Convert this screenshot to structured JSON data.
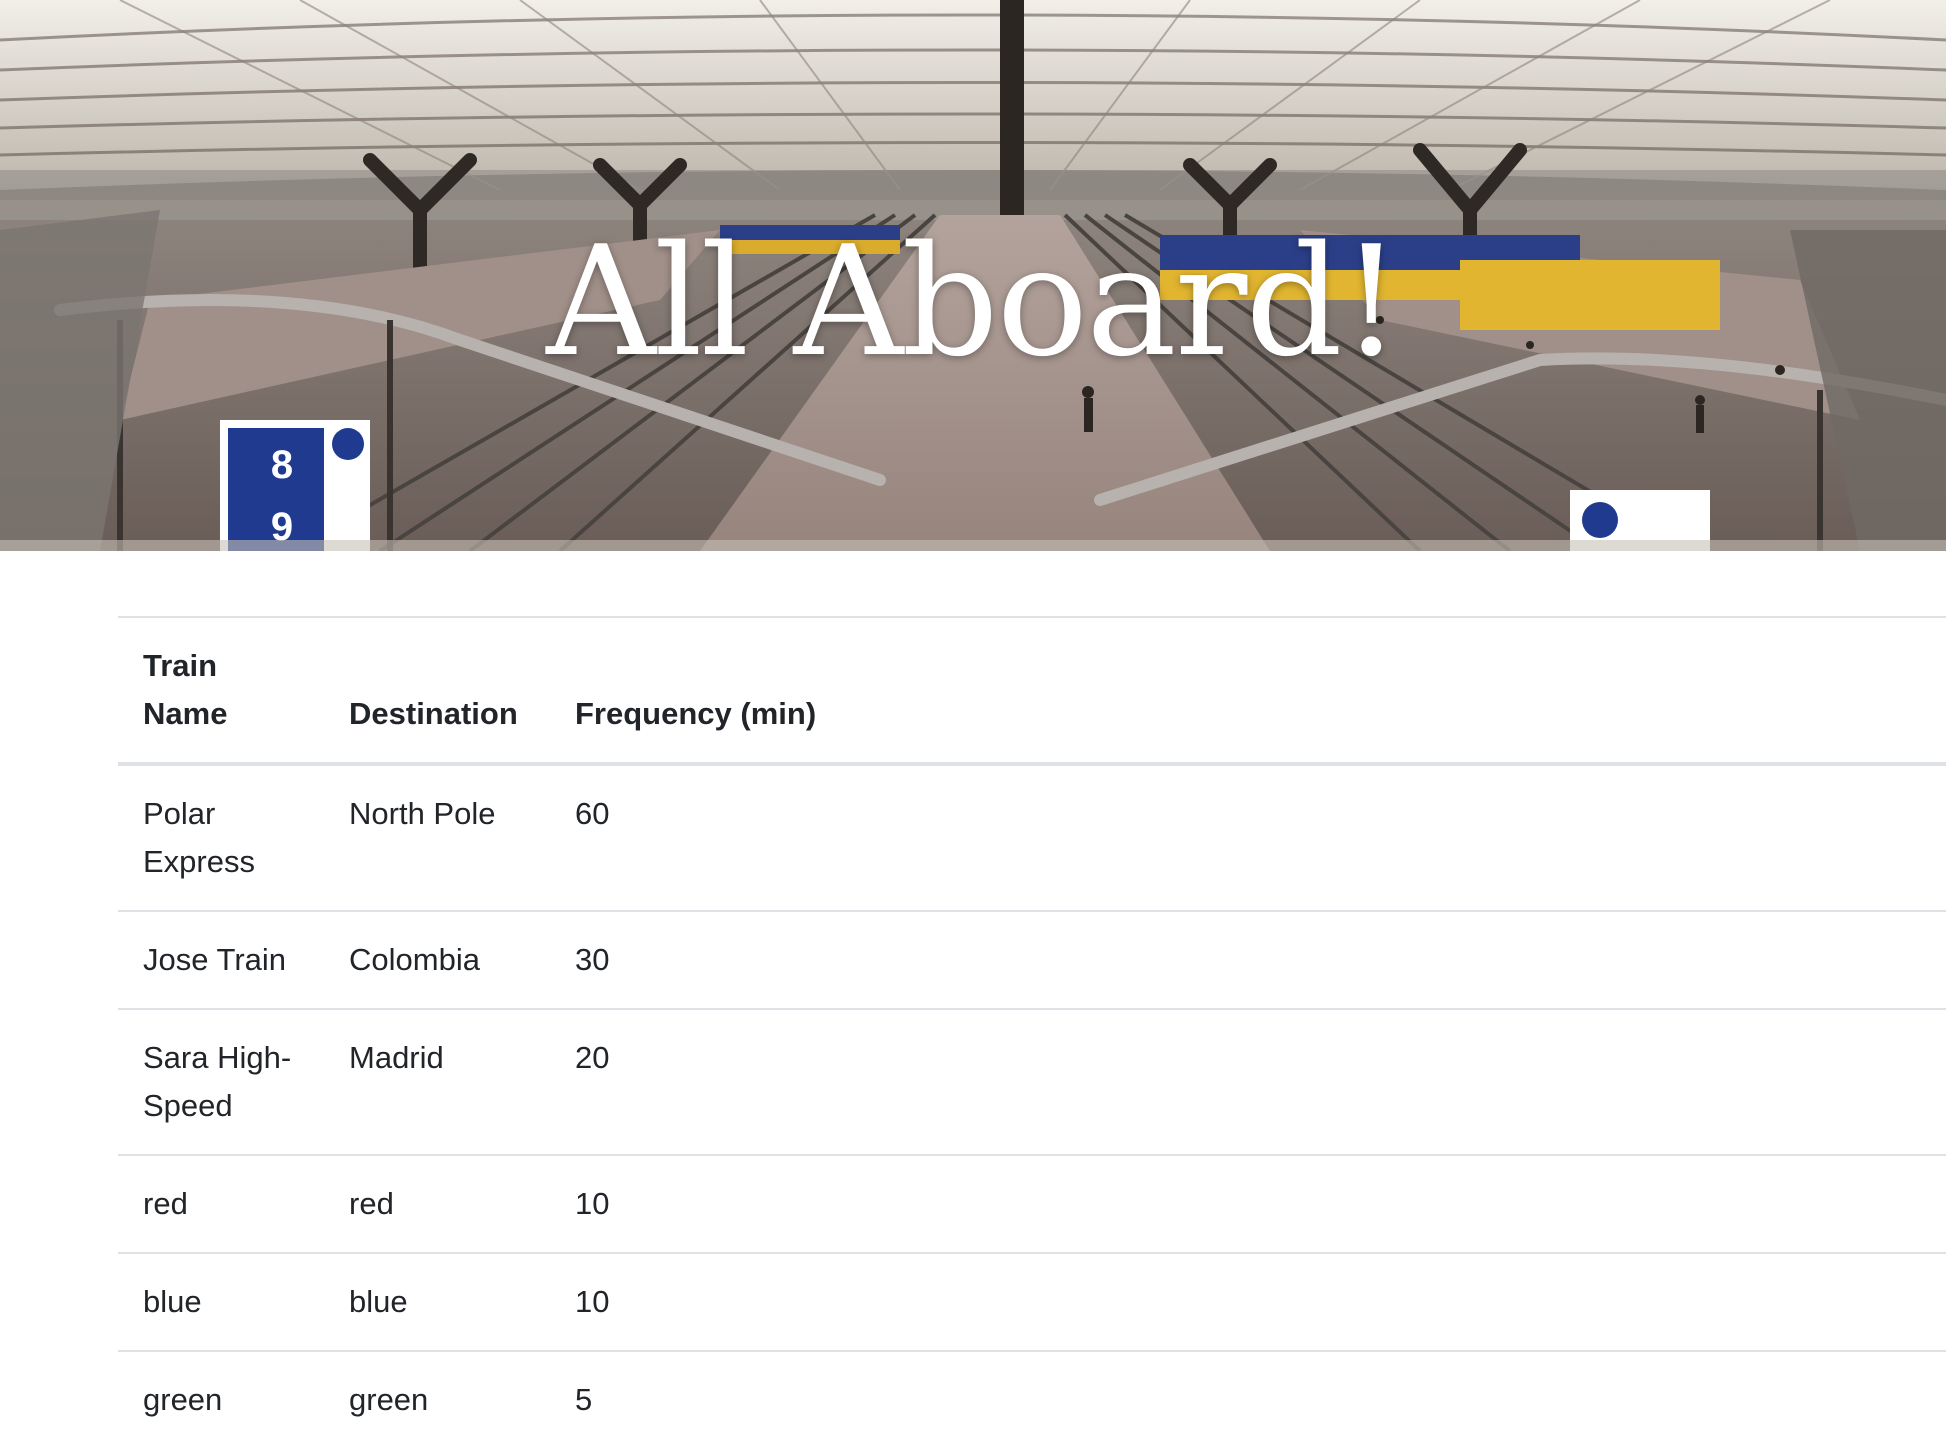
{
  "hero": {
    "title": "All Aboard!",
    "platform_numbers": [
      "8",
      "9"
    ]
  },
  "table": {
    "headers": {
      "name": "Train Name",
      "destination": "Destination",
      "frequency": "Frequency (min)"
    },
    "rows": [
      {
        "name": "Polar Express",
        "destination": "North Pole",
        "frequency": "60"
      },
      {
        "name": "Jose Train",
        "destination": "Colombia",
        "frequency": "30"
      },
      {
        "name": "Sara High-Speed",
        "destination": "Madrid",
        "frequency": "20"
      },
      {
        "name": "red",
        "destination": "red",
        "frequency": "10"
      },
      {
        "name": "blue",
        "destination": "blue",
        "frequency": "10"
      },
      {
        "name": "green",
        "destination": "green",
        "frequency": "5"
      }
    ]
  },
  "colors": {
    "text": "#212529",
    "border": "#dee2e6",
    "hero_text": "#ffffff"
  }
}
